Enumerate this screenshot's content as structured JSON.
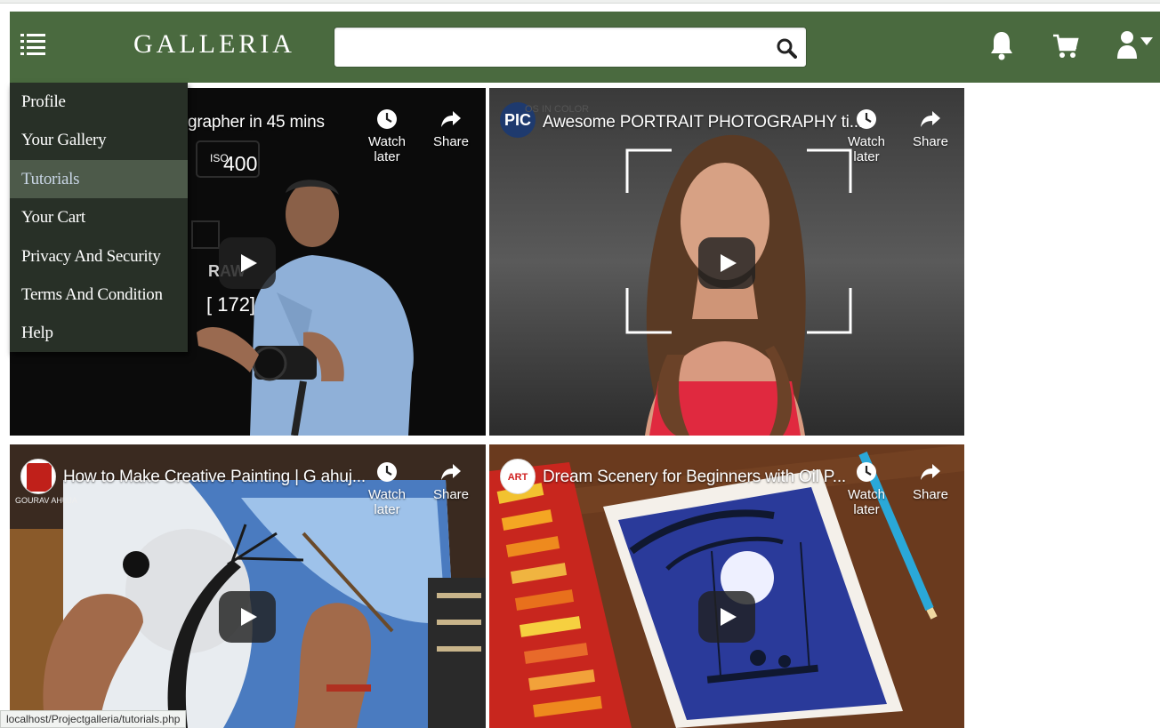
{
  "app": {
    "brand": "GALLERIA"
  },
  "search": {
    "value": "",
    "placeholder": ""
  },
  "nav_icons": [
    "menu-icon",
    "search-icon",
    "bell-icon",
    "cart-icon",
    "user-icon",
    "caret-down-icon"
  ],
  "colors": {
    "navbar": "#4a6a3f",
    "dropdown": "#283027",
    "dropdown_active": "#4d5a4a"
  },
  "dropdown": {
    "items": [
      {
        "label": "Profile"
      },
      {
        "label": "Your Gallery"
      },
      {
        "label": "Tutorials",
        "active": true
      },
      {
        "label": "Your Cart"
      },
      {
        "label": "Privacy And Security"
      },
      {
        "label": "Terms And Condition"
      },
      {
        "label": "Help"
      }
    ]
  },
  "videos": [
    {
      "title": "grapher in 45 mins",
      "watch_later": "Watch later",
      "share": "Share",
      "overlay": {
        "iso_label": "ISO",
        "iso_value": "400",
        "raw": "RAW",
        "count": "[ 172]"
      }
    },
    {
      "title": "Awesome PORTRAIT PHOTOGRAPHY ti...",
      "channel": "PIC",
      "channel_sub": "OS IN COLOR",
      "watch_later": "Watch later",
      "share": "Share"
    },
    {
      "title": "How to Make Creative Painting | G ahuj...",
      "channel_sub": "GOURAV AHUJA",
      "watch_later": "Watch later",
      "share": "Share"
    },
    {
      "title": "Dream Scenery for Beginners with Oil P...",
      "channel": "ART",
      "watch_later": "Watch later",
      "share": "Share"
    }
  ],
  "status_bar": {
    "url": "localhost/Projectgalleria/tutorials.php"
  }
}
